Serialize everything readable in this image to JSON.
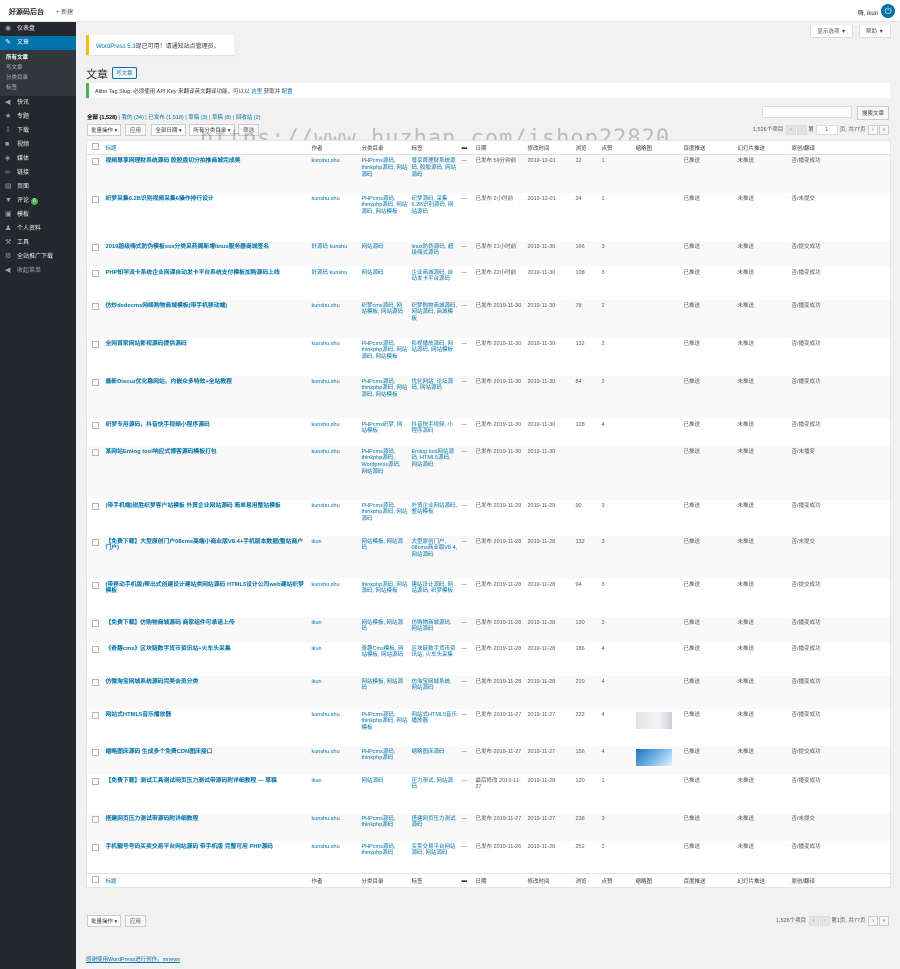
{
  "adminbar": {
    "site_title": "好源码后台",
    "new_label": "+ 新建",
    "howdy": "嗨, ikun"
  },
  "sidebar": {
    "items_top": [
      {
        "label": "仪表盘",
        "icon": "dashboard-icon",
        "glyph": "◉"
      }
    ],
    "posts": {
      "label": "文章",
      "icon": "pin-icon",
      "glyph": "✎"
    },
    "posts_sub": [
      "所有文章",
      "写文章",
      "分类目录",
      "标签"
    ],
    "items_bottom": [
      {
        "label": "快讯",
        "icon": "megaphone-icon",
        "glyph": "◀"
      },
      {
        "label": "专题",
        "icon": "star-icon",
        "glyph": "★"
      },
      {
        "label": "下载",
        "icon": "download-icon",
        "glyph": "⇩"
      },
      {
        "label": "视频",
        "icon": "video-icon",
        "glyph": "■"
      },
      {
        "label": "媒体",
        "icon": "media-icon",
        "glyph": "◈"
      },
      {
        "label": "链接",
        "icon": "link-icon",
        "glyph": "∞"
      },
      {
        "label": "页面",
        "icon": "page-icon",
        "glyph": "▤"
      },
      {
        "label": "评论",
        "icon": "comment-icon",
        "glyph": "▼",
        "badge": "6"
      },
      {
        "label": "模板",
        "icon": "appearance-icon",
        "glyph": "▣"
      },
      {
        "label": "个人资料",
        "icon": "user-icon",
        "glyph": "♟"
      },
      {
        "label": "工具",
        "icon": "tools-icon",
        "glyph": "⚒"
      },
      {
        "label": "全站推广下载",
        "icon": "gear-icon",
        "glyph": "⚙"
      }
    ],
    "collapse": {
      "label": "收起菜单",
      "icon": "collapse-icon",
      "glyph": "◀"
    }
  },
  "screen_options": "显示选项 ▼",
  "help": "帮助 ▼",
  "notice": {
    "link": "WordPress 5.3",
    "text": "现已可用！请通知站点管理员。"
  },
  "page_title": "文章",
  "write_button": "写文章",
  "tag_notice": {
    "text": "Alibo Tag Slug: 必须使用 API Key 来翻译英文翻译功能，可以以",
    "link1": "这里",
    "mid": "获取并",
    "link2": "配置"
  },
  "subsubsub": {
    "all": "全部 (1,528)",
    "mine": "我的 (34)",
    "published": "已发布 (1,518)",
    "draft": "草稿 (3)",
    "pending": "草稿 (8)",
    "trash": "回收站 (2)"
  },
  "search": {
    "placeholder": "",
    "button": "搜索文章"
  },
  "tablenav": {
    "bulk": "批量操作",
    "apply": "应用",
    "all_dates": "全部日期",
    "all_cats": "所有分类目录",
    "filter": "筛选",
    "count": "1,526个项目",
    "page": "1",
    "total": "页, 共77页",
    "bottom_page_text": "第1页, 共77页"
  },
  "columns": [
    "标题",
    "作者",
    "分类目录",
    "标签",
    "",
    "日期",
    "修改时间",
    "浏览",
    "点赞",
    "缩略图",
    "百度推送",
    "幻灯片推送",
    "原创/翻译"
  ],
  "posts": [
    {
      "title": "视频尊享网理财系统源码 胶胶盘切分拍推商城完成美",
      "author": "kunshu.shu",
      "cats": "PHPcms源码, thinkphp源码, 网站源码",
      "tags": "尊享首理财系统源码, 胶胶源码, 网站源码",
      "comments": "—",
      "date": "已发布 59分钟前",
      "modified": "2019-12-01",
      "views": "12",
      "likes": "1",
      "thumb": "",
      "baidu": "已推送",
      "slider": "未推送",
      "orig": "否/播变成功"
    },
    {
      "title": "织梦采集6.2B识别视频采集6操作排行设计",
      "author": "kunshu.shu",
      "cats": "PHPcms源码, thinkphp源码, 网站源码, 网站模板",
      "tags": "织梦源码, 采集6.2B识别源码, 网站源码",
      "comments": "—",
      "date": "已发布 2小时前",
      "modified": "2019-12-01",
      "views": "24",
      "likes": "1",
      "thumb": "",
      "baidu": "已推送",
      "slider": "未推送",
      "orig": "否/未提交"
    },
    {
      "title": "2019超级嗨式防伪模板sss分类采药阁新增linux服务器商城签名",
      "author": "好源码 kunshu",
      "cats": "网站源码",
      "tags": "linux防伪源码, 超级嗨式源码",
      "comments": "—",
      "date": "已发布 21小时前",
      "modified": "2019-11-30",
      "views": "166",
      "likes": "3",
      "thumb": "",
      "baidu": "已推送",
      "slider": "未推送",
      "orig": "否/提交成功"
    },
    {
      "title": "PHP知学派卡系统企业网课自动发卡平台系统支付模板加购源码上线",
      "author": "好源码 kunshu",
      "cats": "网站源码",
      "tags": "企业商城源码, 自动发卡平台源码",
      "comments": "—",
      "date": "已发布 22小时前",
      "modified": "2019-11-30",
      "views": "108",
      "likes": "3",
      "thumb": "",
      "baidu": "已推送",
      "slider": "未推送",
      "orig": "否/播变成功"
    },
    {
      "title": "仿炒dedecms网络购物商城模板(带手机移动端)",
      "author": "kunshu.shu",
      "cats": "织梦cms源码, 网站模板, 网站源码",
      "tags": "织梦购物商城源码, 网站源码, 商城模板",
      "comments": "—",
      "date": "已发布 2019-11-30",
      "modified": "2019-11-30",
      "views": "78",
      "likes": "2",
      "thumb": "",
      "baidu": "已推送",
      "slider": "未推送",
      "orig": "否/播变成功"
    },
    {
      "title": "全网首家网站影视源码提供源码",
      "author": "kunshu.shu",
      "cats": "PHPcms源码, thinkphp源码, 网站源码, 网站模板",
      "tags": "影视播放源码, 网站源码, 网站模板",
      "comments": "—",
      "date": "已发布 2019-11-30",
      "modified": "2019-11-30",
      "views": "132",
      "likes": "2",
      "thumb": "",
      "baidu": "已推送",
      "slider": "未推送",
      "orig": "否/播变成功"
    },
    {
      "title": "最新Discuz优化稳网站，内嵌众多特效+全站教程",
      "author": "kunshu.shu",
      "cats": "PHPcms源码, thinkphp源码, 网站源码, 网站模板",
      "tags": "优化网站, 论坛源码, 网站源码",
      "comments": "—",
      "date": "已发布 2019-11-30",
      "modified": "2019-11-30",
      "views": "84",
      "likes": "2",
      "thumb": "",
      "baidu": "已推送",
      "slider": "未推送",
      "orig": "否/播变成功"
    },
    {
      "title": "织梦专用源码，抖音快手视频小程序源码",
      "author": "kunshu.shu",
      "cats": "PHPcms织梦, 网站模板",
      "tags": "抖音快手视频, 小程序源码",
      "comments": "—",
      "date": "已发布 2019-11-30",
      "modified": "2019-11-30",
      "views": "128",
      "likes": "4",
      "thumb": "",
      "baidu": "已推送",
      "slider": "未推送",
      "orig": "否/播变成功"
    },
    {
      "title": "某网站Emlog tool响应式博客源码模板打包",
      "author": "kunshu.shu",
      "cats": "PHPcms源码, thinkphp源码, Wordpress源码, 网站源码",
      "tags": "Emlog tool网站源码, HTML5源码, 网站源码",
      "comments": "—",
      "date": "已发布 2019-11-30",
      "modified": "2019-11-30",
      "views": "",
      "likes": "",
      "thumb": "",
      "baidu": "已推送",
      "slider": "未推送",
      "orig": "否/未播变"
    },
    {
      "title": "(带手机端)锐胜织梦客户站模板 外贸企业网站源码 简单易用整站模板",
      "author": "kunshu.shu",
      "cats": "PHPcms源码, thinkphp源码, 网站源码",
      "tags": "外贸企业网站源码, 整站模板",
      "comments": "—",
      "date": "已发布 2019-11-29",
      "modified": "2019-11-29",
      "views": "90",
      "likes": "3",
      "thumb": "",
      "baidu": "已推送",
      "slider": "未推送",
      "orig": "否/播变成功"
    },
    {
      "title": "【免费下载】大型原创门户08cms高端小商业版V8.4+手机版本数据(整站商户门户)",
      "author": "ikun",
      "cats": "网站模板, 网站源码",
      "tags": "大型原创门户, 08cms商业版V8.4, 网站源码",
      "comments": "—",
      "date": "已发布 2019-11-28",
      "modified": "2019-11-28",
      "views": "132",
      "likes": "3",
      "thumb": "",
      "baidu": "已推送",
      "slider": "未推送",
      "orig": "否/未提交"
    },
    {
      "title": "(带移动手机版)帮出式创建设计建站类网站源码 HTML5设计公司web建站织梦模板",
      "author": "kunshu.shu",
      "cats": "thinkphp源码, 网站源码, 网站模板",
      "tags": "建站设计源码, 网站源码, 织梦模板",
      "comments": "—",
      "date": "已发布 2019-11-28",
      "modified": "2019-11-28",
      "views": "94",
      "likes": "3",
      "thumb": "",
      "baidu": "已推送",
      "slider": "未推送",
      "orig": "否/提交成功"
    },
    {
      "title": "【免费下载】仿购物商城源码 商家组件可承诺上传",
      "author": "ikun",
      "cats": "网站模板, 网站源码",
      "tags": "仿购物商城源码, 网站源码",
      "comments": "—",
      "date": "已发布 2019-11-28",
      "modified": "2019-11-28",
      "views": "130",
      "likes": "2",
      "thumb": "",
      "baidu": "已推送",
      "slider": "未推送",
      "orig": "否/播变成功"
    },
    {
      "title": "《奇趣cms》区块链数字货币资讯站+火车头采集",
      "author": "ikun",
      "cats": "奇趣Cms模板, 网站模板, 网站源码",
      "tags": "区块链数字货币资讯站, 火车头采集",
      "comments": "—",
      "date": "已发布 2019-11-28",
      "modified": "2019-11-28",
      "views": "186",
      "likes": "4",
      "thumb": "",
      "baidu": "已推送",
      "slider": "未推送",
      "orig": "否/播变成功"
    },
    {
      "title": "仿微淘宝网城系统源码完美会员分类",
      "author": "ikun",
      "cats": "网站模板, 网站源码",
      "tags": "仿淘宝网城系统, 网站源码",
      "comments": "—",
      "date": "已发布 2019-11-28",
      "modified": "2019-11-28",
      "views": "210",
      "likes": "4",
      "thumb": "",
      "baidu": "已推送",
      "slider": "未推送",
      "orig": "否/播变成功"
    },
    {
      "title": "网站式HTML5音乐播放器",
      "author": "kunshu.shu",
      "cats": "PHPcms源码, thinkphp源码, 网站模板",
      "tags": "网站式HTML5音乐播放器",
      "comments": "—",
      "date": "已发布 2019-11-27",
      "modified": "2019-11-27",
      "views": "222",
      "likes": "4",
      "thumb": "t1",
      "baidu": "已推送",
      "slider": "未推送",
      "orig": "否/播变成功"
    },
    {
      "title": "缩略图床源码 生成多个免费CDN图床接口",
      "author": "kunshu.shu",
      "cats": "PHPcms源码, thinkphp源码",
      "tags": "缩略图床源码",
      "comments": "—",
      "date": "已发布 2019-11-27",
      "modified": "2019-11-27",
      "views": "156",
      "likes": "4",
      "thumb": "t2",
      "baidu": "已推送",
      "slider": "未推送",
      "orig": "否/提交成功"
    },
    {
      "title": "【免费下载】测试工具测试网页压力测试带源码附详细教程 — 草稿",
      "author": "ikun",
      "cats": "网站源码",
      "tags": "压力测试, 网站源码",
      "comments": "—",
      "date": "最后修改 2019-11-27",
      "modified": "2019-11-28",
      "views": "120",
      "likes": "1",
      "thumb": "",
      "baidu": "已推送",
      "slider": "未推送",
      "orig": "否/播变成功"
    },
    {
      "title": "搭建网页压力测试带源码附详细教程",
      "author": "kunshu.shu",
      "cats": "PHPcms源码, thinkphp源码",
      "tags": "搭建网页压力测试源码",
      "comments": "—",
      "date": "已发布 2019-11-27",
      "modified": "2019-11-27",
      "views": "238",
      "likes": "3",
      "thumb": "",
      "baidu": "已推送",
      "slider": "未推送",
      "orig": "否/未提交"
    },
    {
      "title": "手机靓号号码买卖交易平台网站源码 带手机版 完整可用 PHP源码",
      "author": "kunshu.shu",
      "cats": "PHPcms源码, thinkphp源码",
      "tags": "买卖交易平台网站源码, 网站源码",
      "comments": "—",
      "date": "已发布 2019-11-26",
      "modified": "2019-11-26",
      "views": "252",
      "likes": "2",
      "thumb": "",
      "baidu": "已推送",
      "slider": "未推送",
      "orig": "否/播变成功"
    }
  ],
  "footer_link": "感谢使用WordPress进行创作。mnews",
  "watermark": "https://www.huzhan.com/ishop22820"
}
